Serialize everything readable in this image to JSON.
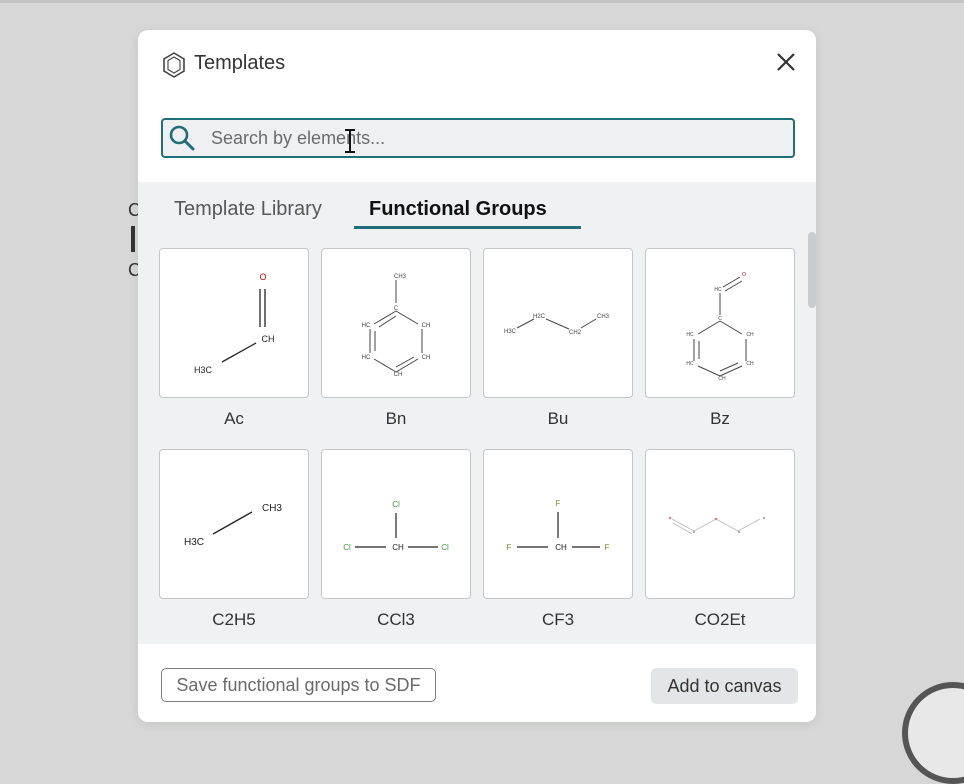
{
  "app": {
    "title": "Templates",
    "search": {
      "placeholder": "Search by elements...",
      "value": ""
    },
    "tabs": [
      {
        "label": "Template Library",
        "active": false
      },
      {
        "label": "Functional Groups",
        "active": true
      }
    ],
    "cards": [
      {
        "label": "Ac"
      },
      {
        "label": "Bn"
      },
      {
        "label": "Bu"
      },
      {
        "label": "Bz"
      },
      {
        "label": "C2H5"
      },
      {
        "label": "CCl3"
      },
      {
        "label": "CF3"
      },
      {
        "label": "CO2Et"
      }
    ],
    "footer": {
      "save_label": "Save functional groups to SDF",
      "add_label": "Add to canvas"
    }
  },
  "structures": {
    "ac": {
      "o": "O",
      "ch": "CH",
      "h3c": "H3C"
    },
    "bn": {
      "ch3": "CH3",
      "c": "C",
      "hc": "HC",
      "ch": "CH"
    },
    "bu": {
      "h3c": "H3C",
      "h2c": "H2C",
      "ch2": "CH2",
      "ch3": "CH3"
    },
    "bz": {
      "hc": "HC",
      "o": "O",
      "c": "C",
      "ch": "CH"
    },
    "c2h5": {
      "ch3": "CH3",
      "h3c": "H3C"
    },
    "ccl3": {
      "cl": "Cl",
      "ch": "CH"
    },
    "cf3": {
      "f": "F",
      "ch": "CH"
    }
  },
  "colors": {
    "accent": "#1f6e7a",
    "oxygen": "#cc0000",
    "halogen_cl": "#3a9a3a",
    "halogen_f": "#8a8a2a"
  },
  "icons": {
    "logo": "hexagon-icon",
    "close": "close-icon",
    "search": "search-icon"
  }
}
